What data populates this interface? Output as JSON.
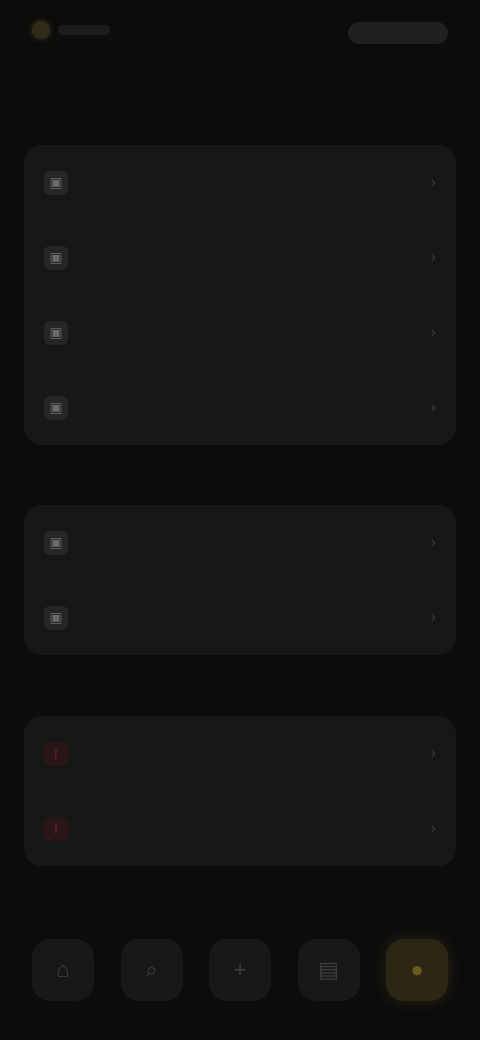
{
  "header": {
    "logo_icon": "app-logo",
    "actions_icon": "account-pill"
  },
  "page": {
    "title": "",
    "subtitle": ""
  },
  "sections": [
    {
      "label": "",
      "items": [
        {
          "label": "",
          "icon": "square-icon"
        },
        {
          "label": "",
          "icon": "square-icon"
        },
        {
          "label": "",
          "icon": "square-icon"
        },
        {
          "label": "",
          "icon": "square-icon"
        }
      ]
    },
    {
      "label": "",
      "items": [
        {
          "label": "",
          "icon": "square-icon"
        },
        {
          "label": "",
          "icon": "square-icon"
        }
      ]
    },
    {
      "label": "",
      "items": [
        {
          "label": "",
          "icon": "warning-icon"
        },
        {
          "label": "",
          "icon": "warning-icon"
        }
      ]
    }
  ],
  "nav": {
    "tabs": [
      {
        "icon": "home-icon"
      },
      {
        "icon": "search-icon"
      },
      {
        "icon": "add-icon"
      },
      {
        "icon": "inbox-icon"
      },
      {
        "icon": "profile-icon",
        "active": true
      }
    ]
  },
  "colors": {
    "background": "#0c0c0c",
    "card": "#171717",
    "accent": "#6a5a22",
    "danger": "#5a2222"
  }
}
